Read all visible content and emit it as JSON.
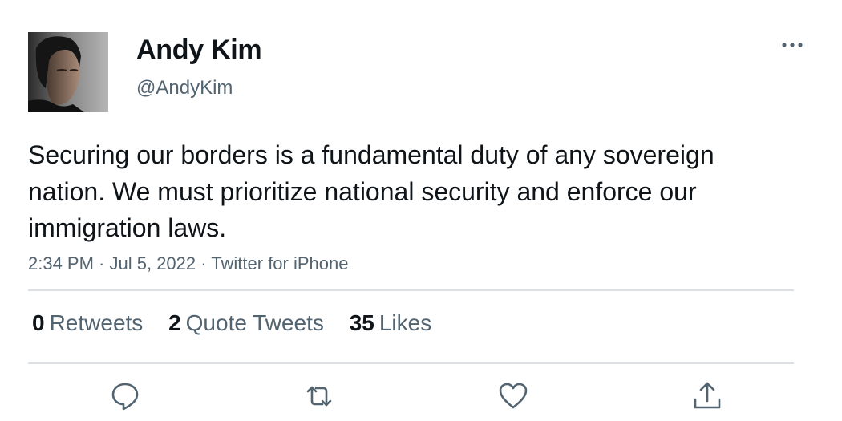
{
  "user": {
    "display_name": "Andy Kim",
    "handle": "@AndyKim"
  },
  "tweet": {
    "text": "Securing our borders is a fundamental duty of any sovereign nation. We must prioritize national security and enforce our immigration laws.",
    "time": "2:34 PM",
    "separator_1": " · ",
    "date": "Jul 5, 2022",
    "separator_2": " · ",
    "source": "Twitter for iPhone"
  },
  "stats": {
    "retweets_count": "0",
    "retweets_label": "Retweets",
    "quotes_count": "2",
    "quotes_label": "Quote Tweets",
    "likes_count": "35",
    "likes_label": "Likes"
  },
  "actions": {
    "reply_icon": "speech-bubble-icon",
    "retweet_icon": "retweet-arrows-icon",
    "like_icon": "heart-icon",
    "share_icon": "share-upload-icon"
  },
  "colors": {
    "text_primary": "#0f1419",
    "text_secondary": "#536471",
    "divider": "#dcdfe3"
  }
}
